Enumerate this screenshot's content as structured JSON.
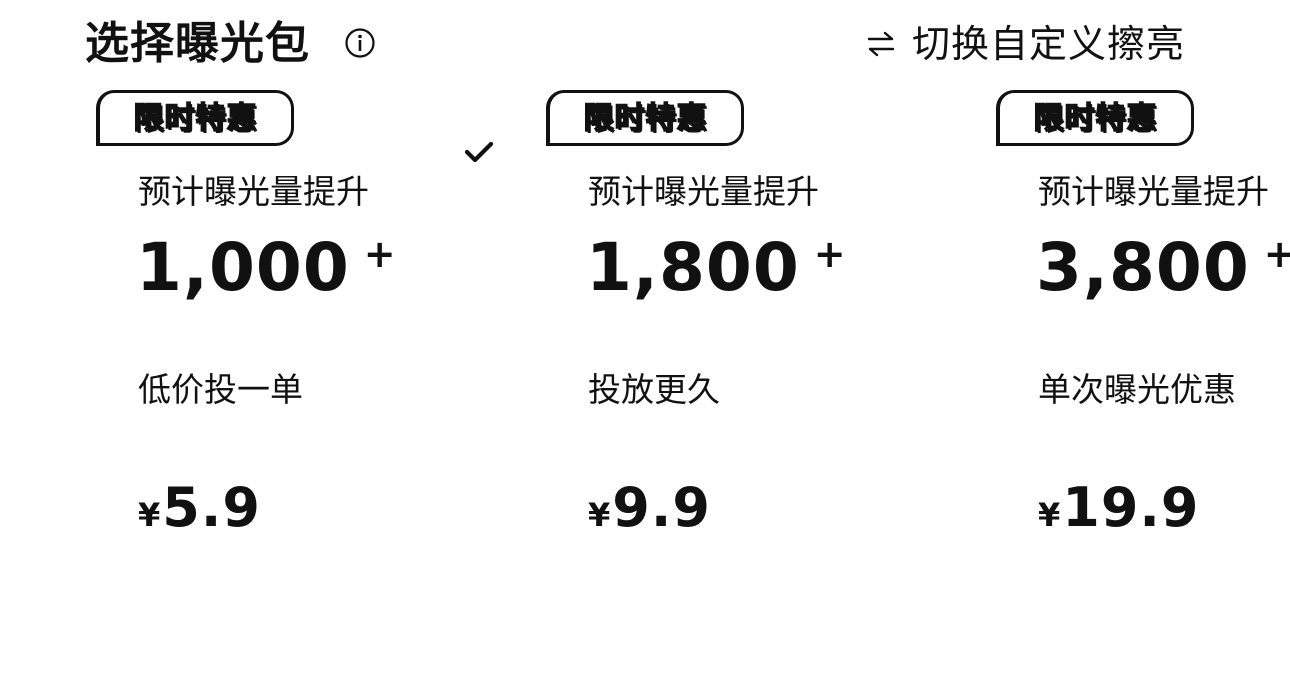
{
  "header": {
    "title": "选择曝光包",
    "info_icon": "info-circle-icon",
    "switch_icon": "swap-arrows-icon",
    "switch_label": "切换自定义擦亮"
  },
  "packages": [
    {
      "badge": "限时特惠",
      "metric_label": "预计曝光量提升",
      "metric_value": "1,000",
      "metric_suffix": "+",
      "description": "低价投一单",
      "currency": "¥",
      "price": "5.9",
      "selected": true
    },
    {
      "badge": "限时特惠",
      "metric_label": "预计曝光量提升",
      "metric_value": "1,800",
      "metric_suffix": "+",
      "description": "投放更久",
      "currency": "¥",
      "price": "9.9",
      "selected": false
    },
    {
      "badge": "限时特惠",
      "metric_label": "预计曝光量提升",
      "metric_value": "3,800",
      "metric_suffix": "+",
      "description": "单次曝光优惠",
      "currency": "¥",
      "price": "19.9",
      "selected": false
    }
  ],
  "colors": {
    "text": "#111111",
    "background": "#ffffff"
  }
}
